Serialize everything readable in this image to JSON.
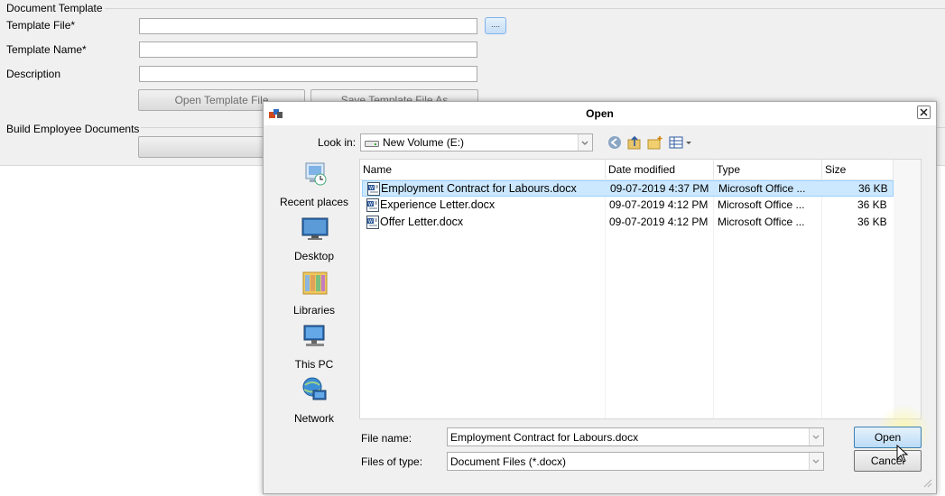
{
  "form": {
    "group_document_template": "Document Template",
    "template_file_label": "Template File*",
    "template_name_label": "Template Name*",
    "description_label": "Description",
    "browse_label": "....",
    "open_template_button": "Open Template File",
    "save_template_button": "Save Template File As",
    "group_build_documents": "Build Employee Documents"
  },
  "dialog": {
    "title": "Open",
    "look_in_label": "Look in:",
    "look_in_value": "New Volume (E:)",
    "places": [
      {
        "label": "Recent places",
        "icon": "recent-places-icon"
      },
      {
        "label": "Desktop",
        "icon": "desktop-icon"
      },
      {
        "label": "Libraries",
        "icon": "libraries-icon"
      },
      {
        "label": "This PC",
        "icon": "this-pc-icon"
      },
      {
        "label": "Network",
        "icon": "network-icon"
      }
    ],
    "columns": [
      "Name",
      "Date modified",
      "Type",
      "Size"
    ],
    "files": [
      {
        "name": "Employment Contract for Labours.docx",
        "date": "09-07-2019 4:37 PM",
        "type": "Microsoft Office ...",
        "size": "36 KB",
        "selected": true
      },
      {
        "name": "Experience Letter.docx",
        "date": "09-07-2019 4:12 PM",
        "type": "Microsoft Office ...",
        "size": "36 KB",
        "selected": false
      },
      {
        "name": "Offer Letter.docx",
        "date": "09-07-2019 4:12 PM",
        "type": "Microsoft Office ...",
        "size": "36 KB",
        "selected": false
      }
    ],
    "file_name_label": "File name:",
    "file_name_value": "Employment Contract for Labours.docx",
    "files_of_type_label": "Files of type:",
    "files_of_type_value": "Document Files (*.docx)",
    "open_button": "Open",
    "cancel_button": "Cancel"
  },
  "colors": {
    "selection": "#cce8ff",
    "accent": "#3c7fb1"
  }
}
